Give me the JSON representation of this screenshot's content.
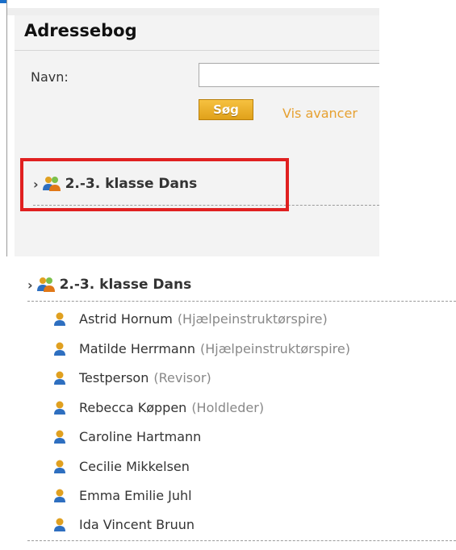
{
  "address_book": {
    "title": "Adressebog",
    "name_label": "Navn:",
    "name_value": "",
    "search_label": "Søg",
    "advanced_link": "Vis avancer"
  },
  "group": {
    "name": "2.-3. klasse Dans"
  },
  "members": [
    {
      "name": "Astrid Hornum",
      "role": "(Hjælpeinstruktørspire)"
    },
    {
      "name": "Matilde Herrmann",
      "role": "(Hjælpeinstruktørspire)"
    },
    {
      "name": "Testperson",
      "role": "(Revisor)"
    },
    {
      "name": "Rebecca Køppen",
      "role": "(Holdleder)"
    },
    {
      "name": "Caroline Hartmann",
      "role": ""
    },
    {
      "name": "Cecilie Mikkelsen",
      "role": ""
    },
    {
      "name": "Emma Emilie Juhl",
      "role": ""
    },
    {
      "name": "Ida Vincent Bruun",
      "role": ""
    }
  ],
  "colors": {
    "highlight": "#e02020",
    "accent_orange": "#e6a030",
    "icons": [
      "chevron-right-icon",
      "group-icon",
      "person-icon"
    ]
  }
}
